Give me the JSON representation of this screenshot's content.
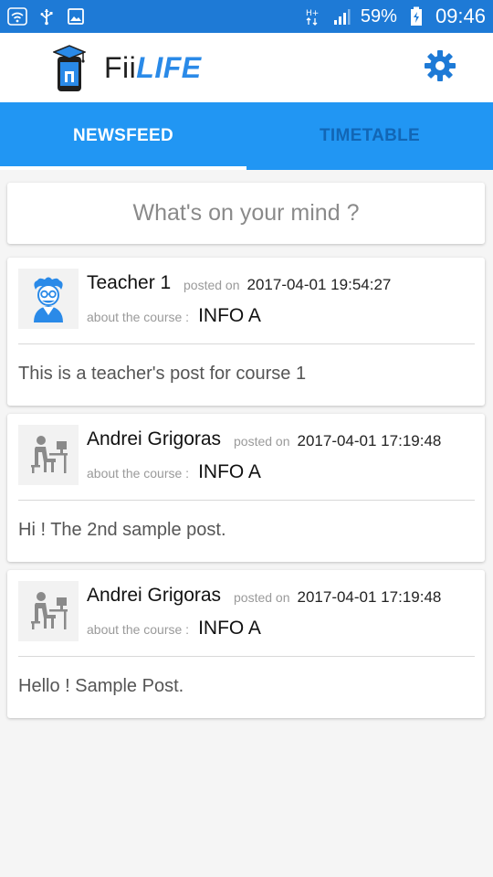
{
  "status_bar": {
    "battery_percent": "59%",
    "time": "09:46",
    "icons": [
      "wifi-icon",
      "usb-icon",
      "gallery-icon",
      "network-hplus-icon",
      "signal-icon",
      "battery-charging-icon"
    ]
  },
  "header": {
    "brand_prefix": "Fii",
    "brand_suffix": "LIFE",
    "brand_color": "#2a8ae8",
    "settings_icon": "gear-icon"
  },
  "tabs": [
    {
      "label": "NEWSFEED",
      "active": true
    },
    {
      "label": "TIMETABLE",
      "active": false
    }
  ],
  "composer": {
    "placeholder": "What's on your mind ?"
  },
  "posts": [
    {
      "author": "Teacher 1",
      "posted_on_label": "posted on",
      "timestamp": "2017-04-01 19:54:27",
      "about_label": "about the course :",
      "course": "INFO A",
      "body": "This is a teacher's post for course 1",
      "avatar": "teacher-avatar"
    },
    {
      "author": "Andrei Grigoras",
      "posted_on_label": "posted on",
      "timestamp": "2017-04-01 17:19:48",
      "about_label": "about the course :",
      "course": "INFO A",
      "body": "Hi ! The 2nd sample post.",
      "avatar": "student-avatar"
    },
    {
      "author": "Andrei Grigoras",
      "posted_on_label": "posted on",
      "timestamp": "2017-04-01 17:19:48",
      "about_label": "about the course :",
      "course": "INFO A",
      "body": "Hello ! Sample Post.",
      "avatar": "student-avatar"
    }
  ],
  "colors": {
    "status_bar": "#1e7ad6",
    "tab_bar": "#2196f3",
    "tab_inactive_text": "#1266b5",
    "background": "#f5f5f5"
  }
}
